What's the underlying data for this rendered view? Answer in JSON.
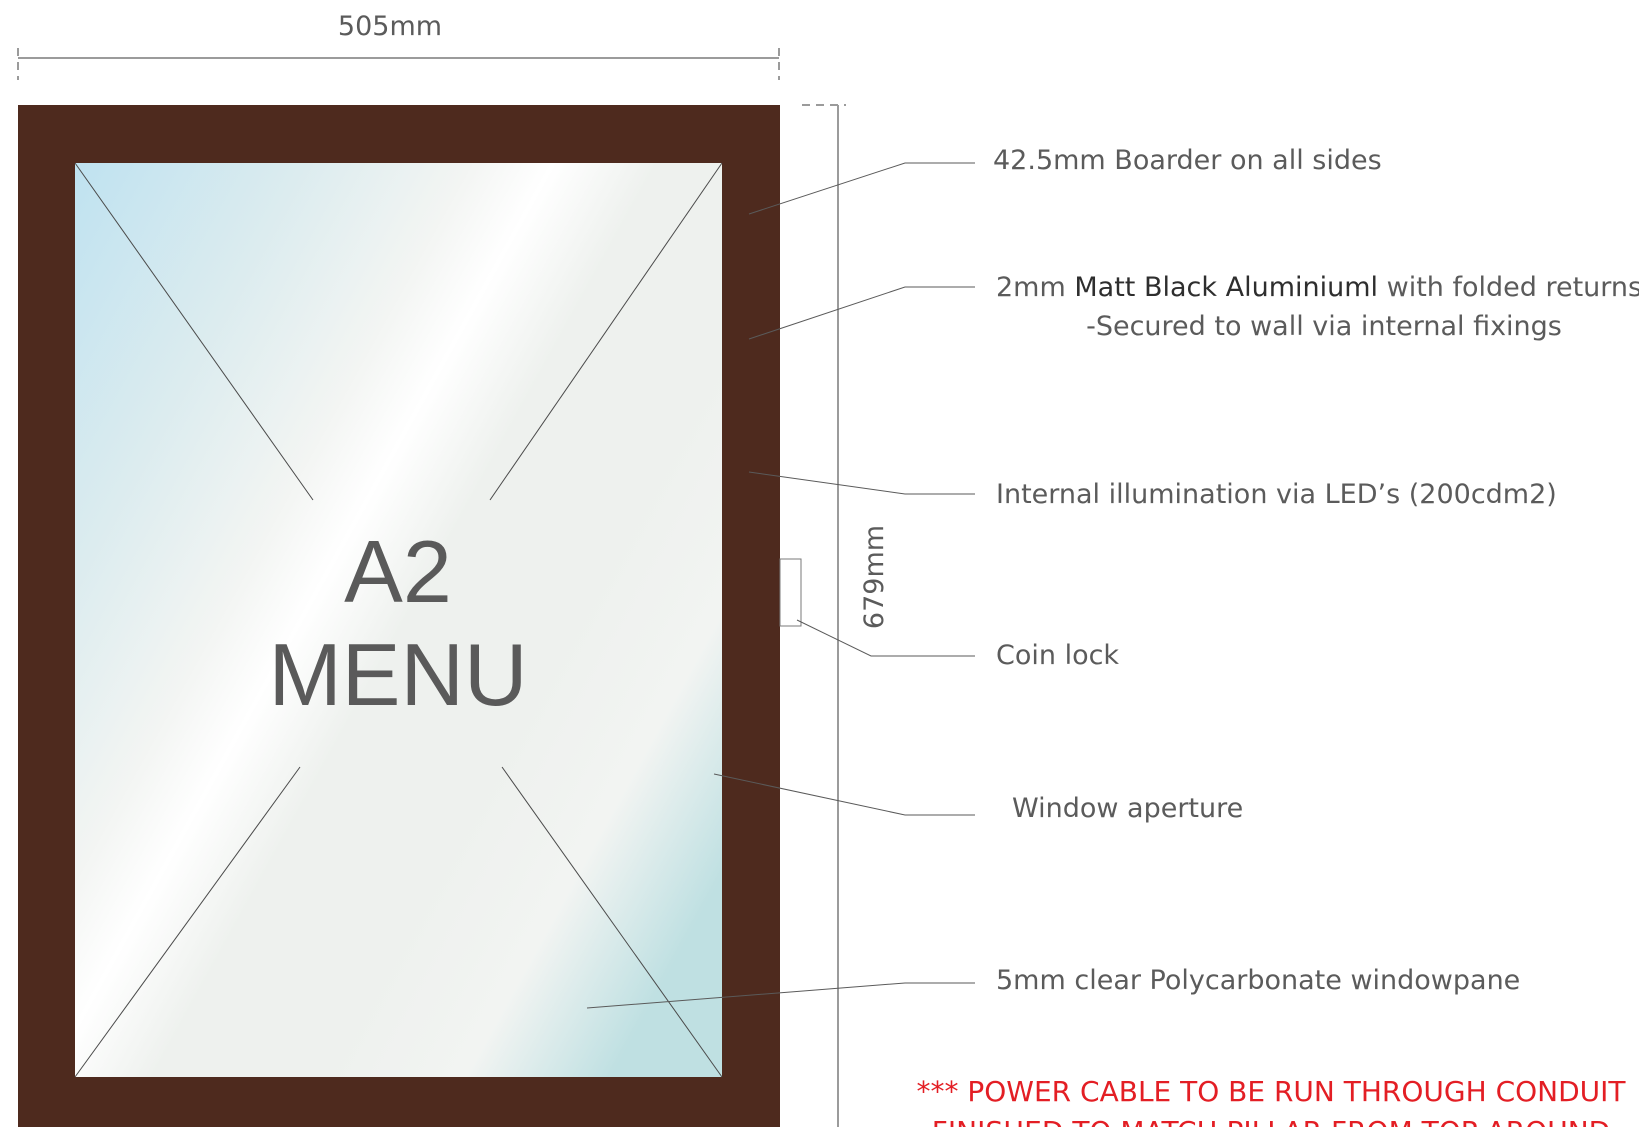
{
  "dimensions": {
    "width_label": "505mm",
    "height_label": "679mm"
  },
  "panel": {
    "line1": "A2",
    "line2": "MENU",
    "frame_color": "#4e2a1e",
    "pane_tint": "#bfe2f0"
  },
  "callouts": {
    "border": "42.5mm Boarder on all sides",
    "material_prefix": "2mm ",
    "material_name": "Matt Black Aluminiuml",
    "material_suffix": " with folded returns",
    "fixing": "-Secured to wall via internal fixings",
    "illumination": "Internal illumination via LED’s (200cdm2)",
    "coin_lock": "Coin lock",
    "aperture": "Window aperture",
    "pane": "5mm clear Polycarbonate windowpane"
  },
  "warning": {
    "line1": "*** POWER CABLE TO BE RUN THROUGH CONDUIT",
    "line2": "FINISHED TO MATCH PILLAR FROM TOP AROUND",
    "color": "#e31e24"
  }
}
